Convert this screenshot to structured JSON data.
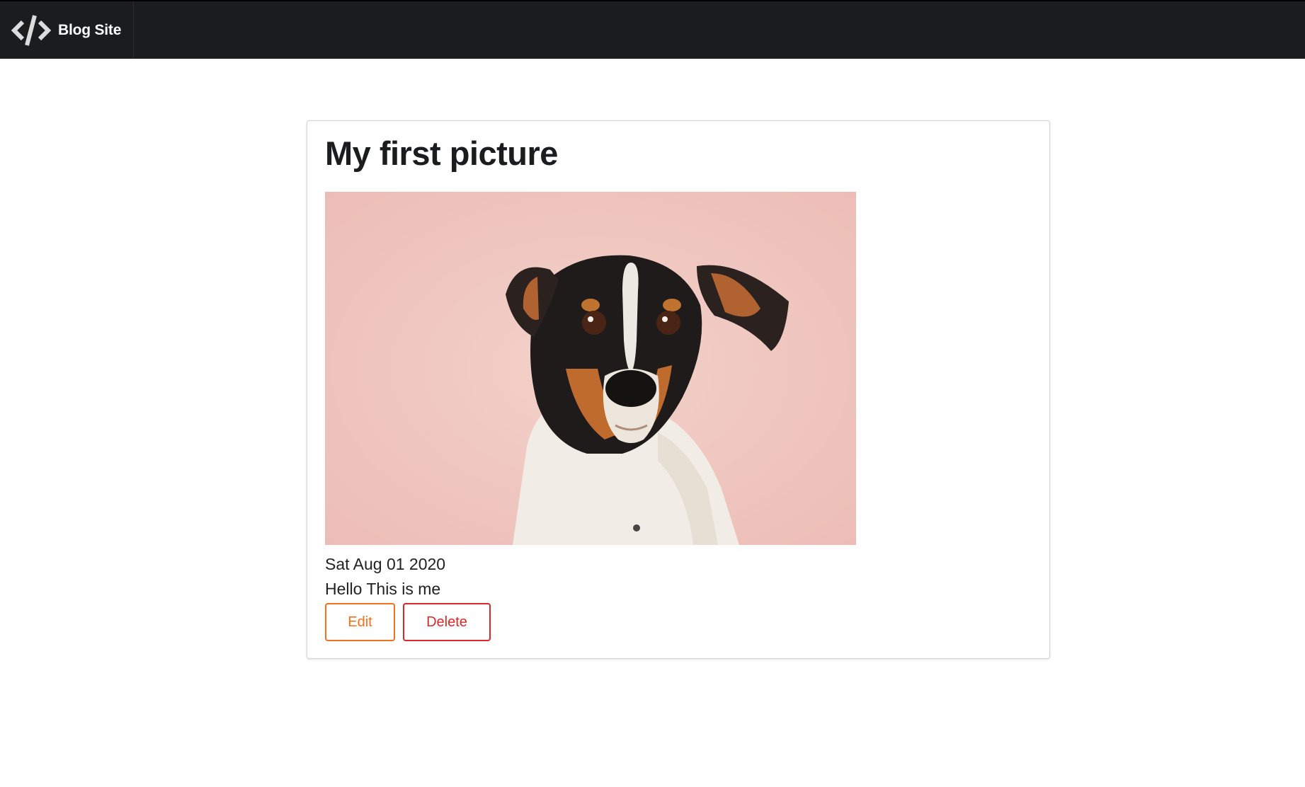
{
  "navbar": {
    "brand_label": "Blog Site",
    "logo_icon": "code-icon",
    "background": "#1b1c1d"
  },
  "post": {
    "title": "My first picture",
    "image_alt": "dog-photo",
    "date": "Sat Aug 01 2020",
    "body": "Hello This is me",
    "actions": {
      "edit_label": "Edit",
      "delete_label": "Delete"
    }
  },
  "colors": {
    "edit": "#f2711c",
    "delete": "#db2828",
    "photo_background": "#f1cfc8"
  }
}
